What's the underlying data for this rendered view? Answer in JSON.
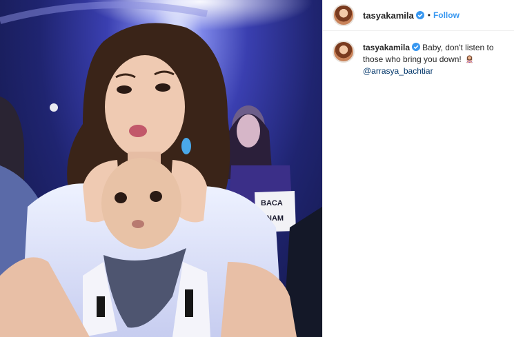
{
  "post": {
    "photo_alt": "",
    "icon": "woman-gesturing-no-emoji"
  },
  "header": {
    "username": "tasyakamila",
    "separator": "•",
    "follow_label": "Follow"
  },
  "caption": {
    "username": "tasyakamila",
    "text": "Baby, don't listen to those who bring you down!",
    "mention": "@arrasya_bachtiar"
  },
  "background_sign": {
    "line1": "BACA",
    "line2": "NAM"
  },
  "colors": {
    "follow_blue": "#3897f0",
    "verified_blue": "#3897f0",
    "text": "#262626",
    "mention": "#003569"
  }
}
